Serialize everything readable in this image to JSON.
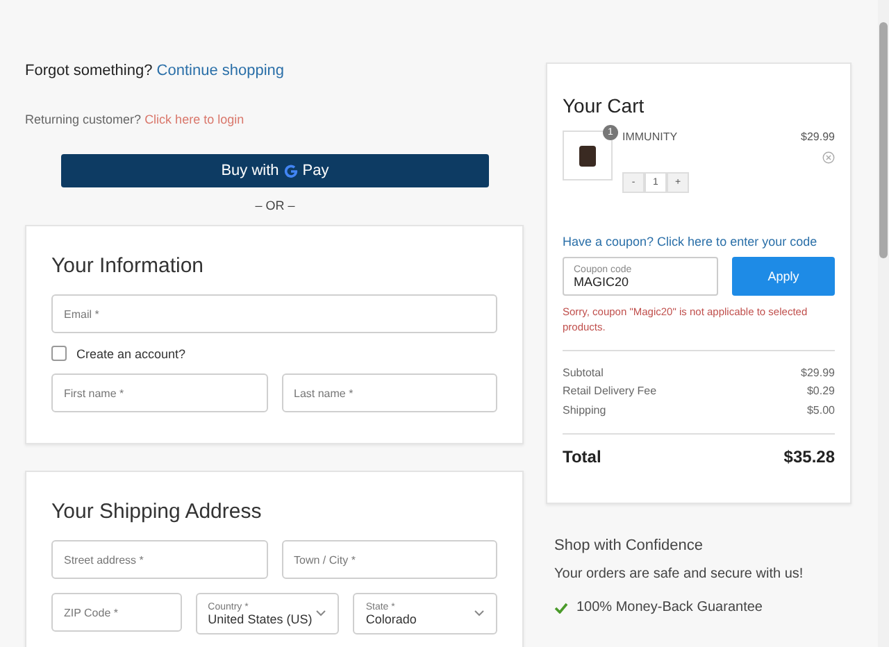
{
  "header": {
    "prompt": "Forgot something?",
    "link": "Continue shopping"
  },
  "login": {
    "prompt": "Returning customer?",
    "link": "Click here to login"
  },
  "express": {
    "button_prefix": "Buy with",
    "button_suffix": "Pay",
    "divider": "– OR –"
  },
  "information": {
    "title": "Your Information",
    "email": {
      "placeholder": "Email *"
    },
    "create_account": {
      "label": "Create an account?",
      "checked": false
    },
    "fields": [
      {
        "kind": "text",
        "placeholder": "First name *"
      },
      {
        "kind": "text",
        "placeholder": "Last name *"
      }
    ]
  },
  "shipping": {
    "title": "Your Shipping Address",
    "fields": [
      {
        "kind": "text",
        "placeholder": "Street address *"
      },
      {
        "kind": "text",
        "placeholder": "Town / City *"
      }
    ],
    "fields_2": [
      {
        "kind": "text",
        "placeholder": "ZIP Code *"
      },
      {
        "kind": "select",
        "label": "Country *",
        "value": "United States (US)"
      },
      {
        "kind": "select",
        "label": "State *",
        "value": "Colorado"
      }
    ]
  },
  "cart": {
    "title": "Your Cart",
    "items": [
      {
        "name": "IMMUNITY",
        "price": "$29.99",
        "badge": "1",
        "minus": "-",
        "quantity": "1",
        "plus": "+"
      }
    ],
    "coupon_link": "Have a coupon? Click here to enter your code",
    "coupon": {
      "label": "Coupon code",
      "value": "MAGIC20"
    },
    "apply": "Apply",
    "error": "Sorry, coupon \"Magic20\" is not applicable to selected products.",
    "lines": [
      {
        "label": "Subtotal",
        "value": "$29.99"
      },
      {
        "label": "Retail Delivery Fee",
        "value": "$0.29"
      },
      {
        "label": "Shipping",
        "value": "$5.00"
      }
    ],
    "total": {
      "label": "Total",
      "value": "$35.28"
    }
  },
  "confidence": {
    "title": "Shop with Confidence",
    "text": "Your orders are safe and secure with us!",
    "items": [
      "100% Money-Back Guarantee"
    ]
  }
}
